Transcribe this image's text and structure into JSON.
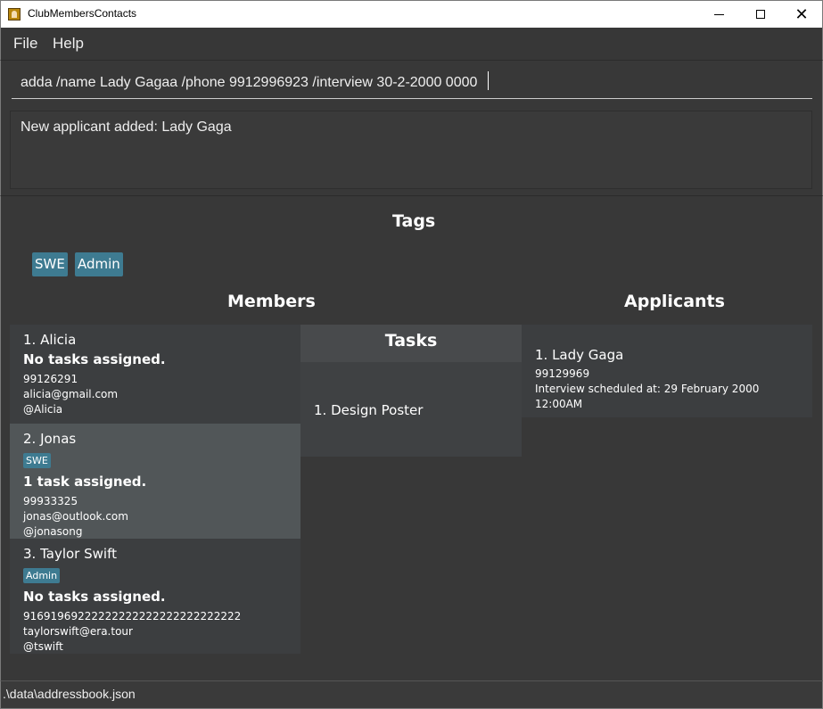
{
  "window": {
    "title": "ClubMembersContacts"
  },
  "menu": {
    "file": "File",
    "help": "Help"
  },
  "command": {
    "value": "adda /name Lady Gagaa /phone 9912996923 /interview 30-2-2000 0000"
  },
  "result": {
    "message": "New applicant added: Lady Gaga"
  },
  "tags": {
    "heading": "Tags",
    "items": [
      "SWE",
      "Admin"
    ]
  },
  "members": {
    "heading": "Members",
    "items": [
      {
        "name": "1.  Alicia",
        "tags": [],
        "tasks": "No tasks assigned.",
        "phone": "99126291",
        "email": "alicia@gmail.com",
        "telegram": "@Alicia"
      },
      {
        "name": "2.  Jonas",
        "tags": [
          "SWE"
        ],
        "tasks": "1 task assigned.",
        "phone": "99933325",
        "email": "jonas@outlook.com",
        "telegram": "@jonasong"
      },
      {
        "name": "3.  Taylor Swift",
        "tags": [
          "Admin"
        ],
        "tasks": "No tasks assigned.",
        "phone": "91691969222222222222222222222222",
        "email": "taylorswift@era.tour",
        "telegram": "@tswift"
      }
    ]
  },
  "tasks": {
    "heading": "Tasks",
    "items": [
      "1.  Design Poster"
    ]
  },
  "applicants": {
    "heading": "Applicants",
    "items": [
      {
        "name": "1.  Lady Gaga",
        "phone": "99129969",
        "interview": "Interview scheduled at: 29 February 2000 12:00AM"
      }
    ]
  },
  "status": {
    "path": ".\\data\\addressbook.json"
  },
  "colors": {
    "tag": "#3e7b91",
    "background": "#383838",
    "selected_card": "#515658"
  }
}
